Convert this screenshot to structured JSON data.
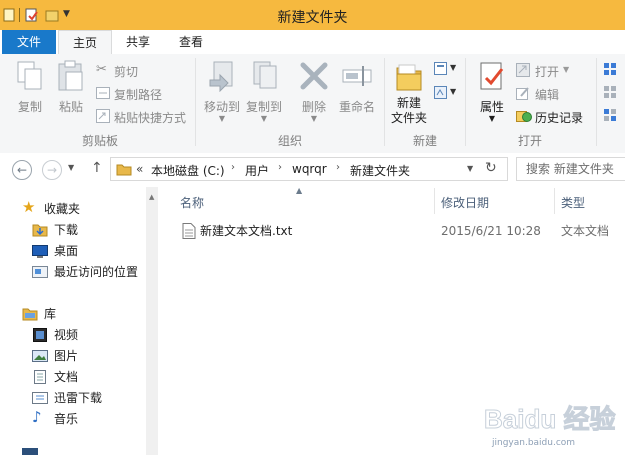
{
  "window": {
    "title": "新建文件夹"
  },
  "tabs": {
    "file": "文件",
    "home": "主页",
    "share": "共享",
    "view": "查看"
  },
  "ribbon": {
    "clipboard": {
      "label": "剪贴板",
      "copy": "复制",
      "paste": "粘贴",
      "cut": "剪切",
      "copy_path": "复制路径",
      "paste_shortcut": "粘贴快捷方式"
    },
    "organize": {
      "label": "组织",
      "move_to": "移动到",
      "copy_to": "复制到",
      "delete": "删除",
      "rename": "重命名"
    },
    "new": {
      "label": "新建",
      "new_folder_line1": "新建",
      "new_folder_line2": "文件夹"
    },
    "open": {
      "label": "打开",
      "properties": "属性",
      "open": "打开",
      "edit": "编辑",
      "history": "历史记录"
    }
  },
  "address": {
    "prefix": "«",
    "crumbs": [
      "本地磁盘 (C:)",
      "用户",
      "wqrqr",
      "新建文件夹"
    ]
  },
  "search": {
    "placeholder": "搜索 新建文件夹"
  },
  "navpane": {
    "favorites": "收藏夹",
    "downloads": "下载",
    "desktop": "桌面",
    "recent": "最近访问的位置",
    "libraries": "库",
    "videos": "视频",
    "pictures": "图片",
    "documents": "文档",
    "thunder": "迅雷下载",
    "music": "音乐"
  },
  "columns": {
    "name": "名称",
    "modified": "修改日期",
    "type": "类型"
  },
  "files": [
    {
      "name": "新建文本文档.txt",
      "modified": "2015/6/21 10:28",
      "type": "文本文档"
    }
  ],
  "watermark": {
    "text": "Baidu 经验",
    "url": "jingyan.baidu.com"
  },
  "colors": {
    "titlebar": "#f6b93f",
    "file_tab": "#1979ca",
    "ribbon_bg": "#f5f6f7",
    "folder": "#e8b84a"
  }
}
